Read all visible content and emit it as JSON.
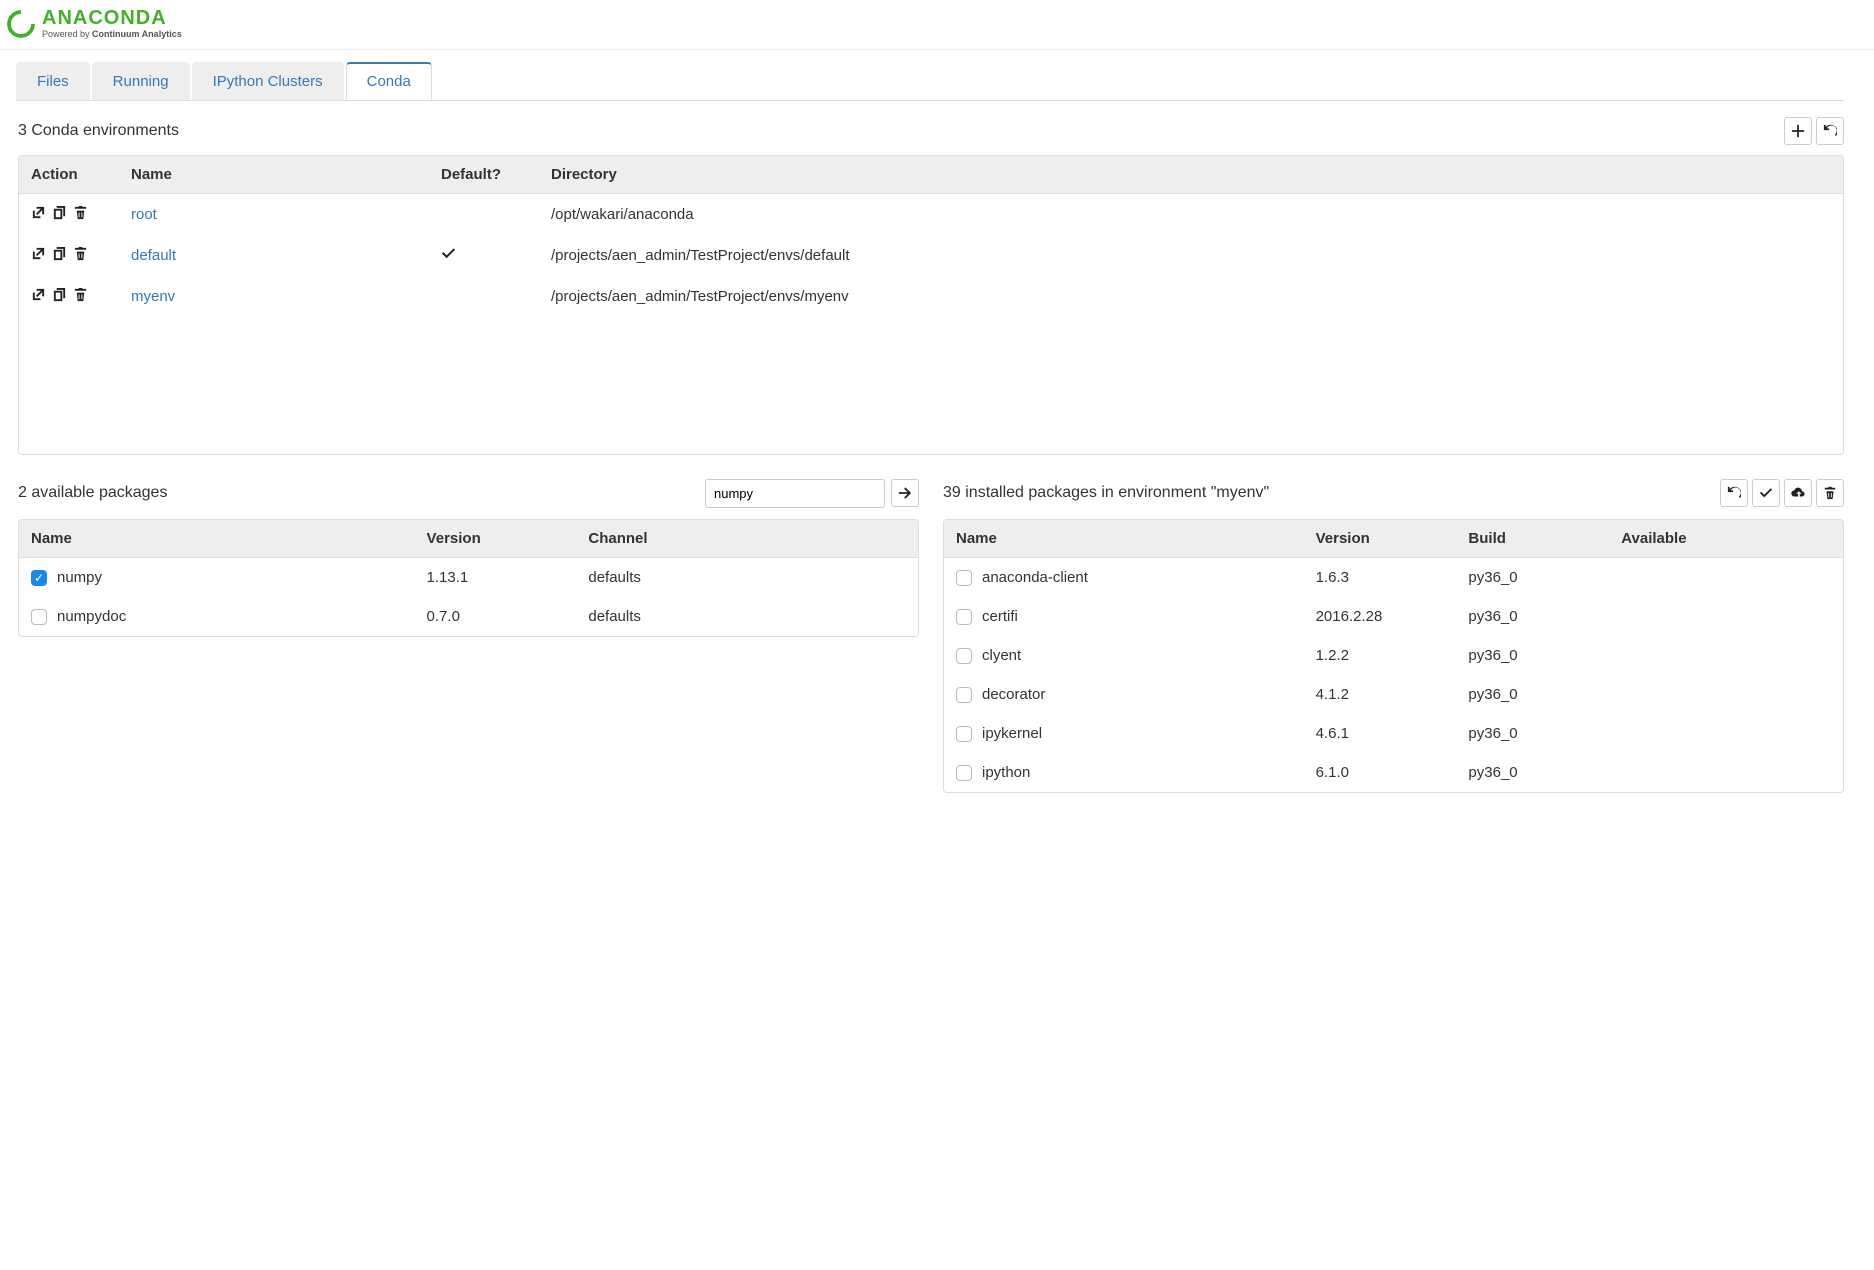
{
  "logo": {
    "title": "ANACONDA",
    "subtitle_prefix": "Powered by ",
    "subtitle_bold": "Continuum Analytics"
  },
  "tabs": [
    {
      "label": "Files",
      "active": false
    },
    {
      "label": "Running",
      "active": false
    },
    {
      "label": "IPython Clusters",
      "active": false
    },
    {
      "label": "Conda",
      "active": true
    }
  ],
  "envs": {
    "title": "3 Conda environments",
    "headers": {
      "action": "Action",
      "name": "Name",
      "default": "Default?",
      "directory": "Directory"
    },
    "rows": [
      {
        "name": "root",
        "default": false,
        "directory": "/opt/wakari/anaconda"
      },
      {
        "name": "default",
        "default": true,
        "directory": "/projects/aen_admin/TestProject/envs/default"
      },
      {
        "name": "myenv",
        "default": false,
        "directory": "/projects/aen_admin/TestProject/envs/myenv"
      }
    ]
  },
  "available": {
    "title": "2 available packages",
    "search_value": "numpy",
    "headers": {
      "name": "Name",
      "version": "Version",
      "channel": "Channel"
    },
    "rows": [
      {
        "name": "numpy",
        "version": "1.13.1",
        "channel": "defaults",
        "checked": true
      },
      {
        "name": "numpydoc",
        "version": "0.7.0",
        "channel": "defaults",
        "checked": false
      }
    ]
  },
  "installed": {
    "title": "39 installed packages in environment \"myenv\"",
    "headers": {
      "name": "Name",
      "version": "Version",
      "build": "Build",
      "available": "Available"
    },
    "rows": [
      {
        "name": "anaconda-client",
        "version": "1.6.3",
        "build": "py36_0",
        "available": "",
        "checked": false
      },
      {
        "name": "certifi",
        "version": "2016.2.28",
        "build": "py36_0",
        "available": "",
        "checked": false
      },
      {
        "name": "clyent",
        "version": "1.2.2",
        "build": "py36_0",
        "available": "",
        "checked": false
      },
      {
        "name": "decorator",
        "version": "4.1.2",
        "build": "py36_0",
        "available": "",
        "checked": false
      },
      {
        "name": "ipykernel",
        "version": "4.6.1",
        "build": "py36_0",
        "available": "",
        "checked": false
      },
      {
        "name": "ipython",
        "version": "6.1.0",
        "build": "py36_0",
        "available": "",
        "checked": false
      }
    ]
  }
}
